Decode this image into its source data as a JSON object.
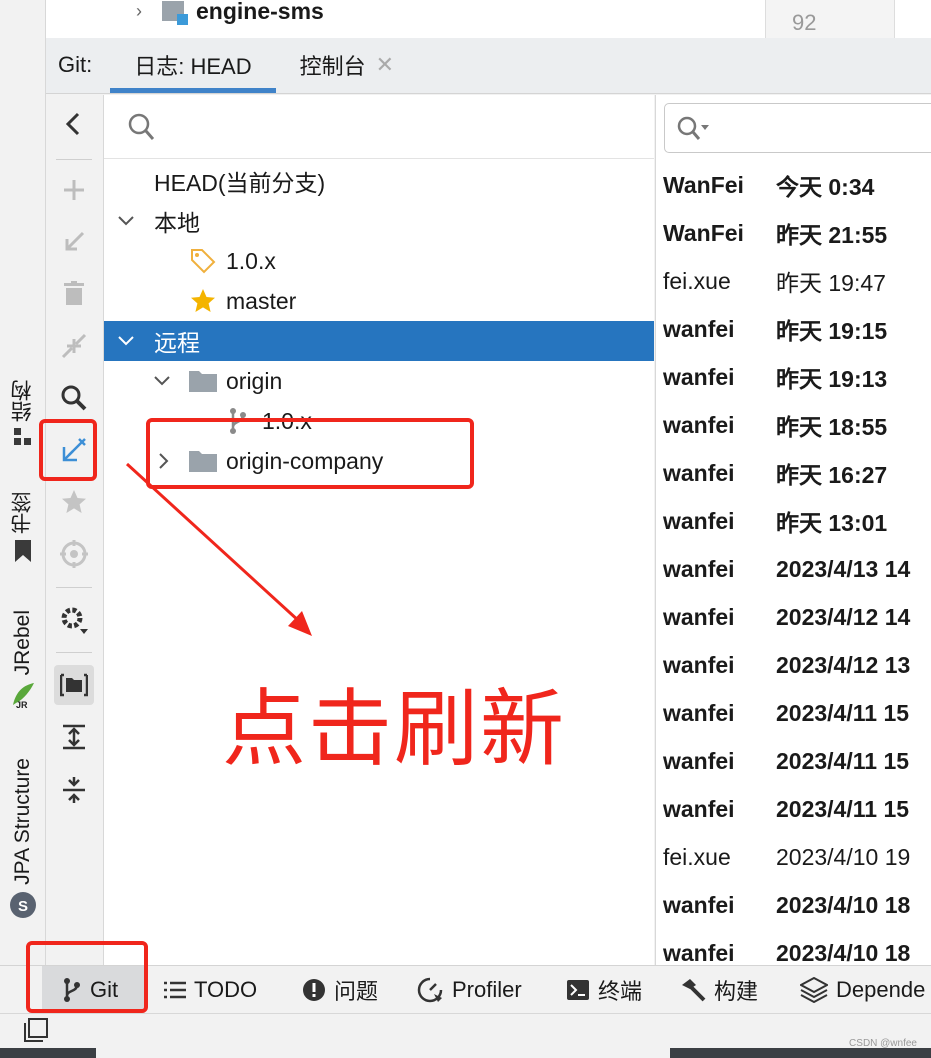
{
  "top_project": {
    "module_name": "engine-sms",
    "line_number": "92"
  },
  "left_strip": {
    "tabs": [
      {
        "id": "structure",
        "label": "结构",
        "icon": "structure-icon"
      },
      {
        "id": "bookmarks",
        "label": "书签",
        "icon": "bookmark-icon"
      },
      {
        "id": "jrebel",
        "label": "JRebel",
        "icon": "jrebel-icon"
      },
      {
        "id": "jpa",
        "label": "JPA Structure",
        "icon": "jpa-icon"
      }
    ]
  },
  "tool_window": {
    "title": "Git:",
    "tabs": [
      {
        "label": "日志: HEAD",
        "active": true,
        "closable": false
      },
      {
        "label": "控制台",
        "active": false,
        "closable": true
      }
    ]
  },
  "toolbar": {
    "buttons": [
      "collapse-left-icon",
      "add-icon",
      "checkout-icon",
      "delete-icon",
      "merge-icon",
      "search-icon",
      "fetch-refresh-icon",
      "favorite-icon",
      "target-icon",
      "settings-icon",
      "group-by-folder-icon",
      "expand-all-icon",
      "collapse-all-icon"
    ]
  },
  "branch_tree": {
    "head": "HEAD(当前分支)",
    "local_label": "本地",
    "local_branches": [
      {
        "name": "1.0.x",
        "icon": "tag-icon"
      },
      {
        "name": "master",
        "icon": "star-icon"
      }
    ],
    "remote_label": "远程",
    "remotes": [
      {
        "name": "origin",
        "expanded": true,
        "branches": [
          "1.0.x"
        ]
      },
      {
        "name": "origin-company",
        "expanded": false,
        "branches": []
      }
    ]
  },
  "commit_log": {
    "commits": [
      {
        "author": "WanFei",
        "date": "今天 0:34",
        "bold": true
      },
      {
        "author": "WanFei",
        "date": "昨天 21:55",
        "bold": true
      },
      {
        "author": "fei.xue",
        "date": "昨天 19:47",
        "bold": false
      },
      {
        "author": "wanfei",
        "date": "昨天 19:15",
        "bold": true
      },
      {
        "author": "wanfei",
        "date": "昨天 19:13",
        "bold": true
      },
      {
        "author": "wanfei",
        "date": "昨天 18:55",
        "bold": true
      },
      {
        "author": "wanfei",
        "date": "昨天 16:27",
        "bold": true
      },
      {
        "author": "wanfei",
        "date": "昨天 13:01",
        "bold": true
      },
      {
        "author": "wanfei",
        "date": "2023/4/13 14",
        "bold": true
      },
      {
        "author": "wanfei",
        "date": "2023/4/12 14",
        "bold": true
      },
      {
        "author": "wanfei",
        "date": "2023/4/12 13",
        "bold": true
      },
      {
        "author": "wanfei",
        "date": "2023/4/11 15",
        "bold": true
      },
      {
        "author": "wanfei",
        "date": "2023/4/11 15",
        "bold": true
      },
      {
        "author": "wanfei",
        "date": "2023/4/11 15",
        "bold": true
      },
      {
        "author": "fei.xue",
        "date": "2023/4/10 19",
        "bold": false
      },
      {
        "author": "wanfei",
        "date": "2023/4/10 18",
        "bold": true
      },
      {
        "author": "wanfei",
        "date": "2023/4/10 18",
        "bold": true
      }
    ]
  },
  "bottom_bar": {
    "tabs": [
      {
        "label": "Git",
        "icon": "git-branch-icon",
        "active": true
      },
      {
        "label": "TODO",
        "icon": "todo-list-icon",
        "active": false
      },
      {
        "label": "问题",
        "icon": "problems-icon",
        "active": false
      },
      {
        "label": "Profiler",
        "icon": "profiler-icon",
        "active": false
      },
      {
        "label": "终端",
        "icon": "terminal-icon",
        "active": false
      },
      {
        "label": "构建",
        "icon": "build-hammer-icon",
        "active": false
      },
      {
        "label": "Depende",
        "icon": "dependencies-icon",
        "active": false
      }
    ]
  },
  "annotation": {
    "text": "点击刷新",
    "color": "#f0261c"
  },
  "watermark": "CSDN @wnfee",
  "colors": {
    "selection": "#2675bf",
    "accent": "#4083c9",
    "annotation_red": "#f0261c",
    "star": "#f4b400"
  }
}
